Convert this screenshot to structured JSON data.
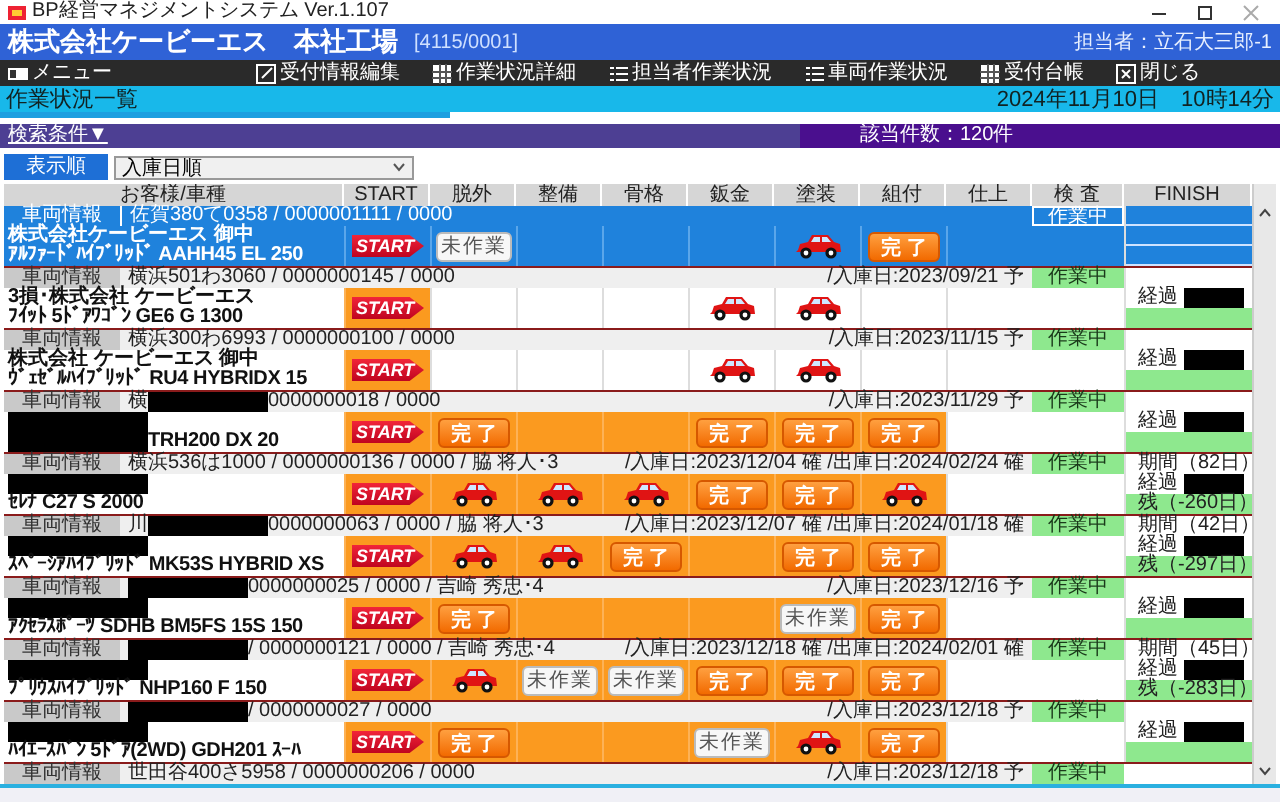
{
  "window": {
    "title": "BP経営マネジメントシステム Ver.1.107"
  },
  "header": {
    "company": "株式会社ケービーエス　本社工場",
    "code": "[4115/0001]",
    "user": "担当者：立石大三郎-1"
  },
  "toolbar": {
    "items": [
      {
        "label": "メニュー"
      },
      {
        "label": "受付情報編集"
      },
      {
        "label": "作業状況詳細"
      },
      {
        "label": "担当者作業状況"
      },
      {
        "label": "車両作業状況"
      },
      {
        "label": "受付台帳"
      }
    ],
    "close": "閉じる"
  },
  "page": {
    "title": "作業状況一覧",
    "datetime": "2024年11月10日　10時14分"
  },
  "search": {
    "label": "検索条件▼",
    "count": "該当件数：120件",
    "sort_button": "表示順",
    "sort_value": "入庫日順"
  },
  "table": {
    "columns": [
      "お客様/車種",
      "START",
      "脱外",
      "整備",
      "骨格",
      "鈑金",
      "塗装",
      "組付",
      "仕上",
      "検 査",
      "FINISH"
    ],
    "rows": [
      {
        "selected": true,
        "info_label": "車両情報",
        "plate": "佐賀380て0358 / 0000001111 / 0000",
        "customer": "株式会社ケービーエス 御中",
        "car": "ｱﾙﾌｧｰﾄﾞﾊｲﾌﾞﾘｯﾄﾞ AAHH45 EL 250",
        "stages": [
          {
            "kind": "start",
            "label": "START"
          },
          {
            "kind": "todo",
            "label": "未作業"
          },
          {
            "kind": "blank"
          },
          {
            "kind": "blank"
          },
          {
            "kind": "blank"
          },
          {
            "kind": "car"
          },
          {
            "kind": "done",
            "label": "完 了"
          },
          {
            "kind": "blank"
          }
        ],
        "inspection": "作業中"
      },
      {
        "selected": false,
        "info_label": "車両情報",
        "plate": "横浜501わ3060 / 0000000145 / 0000",
        "dates": "/入庫日:2023/09/21 予",
        "customer": "3損･株式会社 ケービーエス",
        "car": "ﾌｲｯﾄ 5ﾄﾞｱﾜｺﾞﾝ GE6 G 1300",
        "stages": [
          {
            "kind": "start",
            "label": "START",
            "active": true
          },
          {
            "kind": "blank",
            "active": false
          },
          {
            "kind": "blank",
            "active": false
          },
          {
            "kind": "blank",
            "active": false
          },
          {
            "kind": "car",
            "active": false
          },
          {
            "kind": "car",
            "active": false
          },
          {
            "kind": "blank",
            "active": false
          },
          {
            "kind": "blank",
            "active": false
          }
        ],
        "inspection": "作業中",
        "finish": {
          "elapsed": "経過",
          "elapsed_redacted": true
        }
      },
      {
        "selected": false,
        "info_label": "車両情報",
        "plate": "横浜300わ6993 / 0000000100 / 0000",
        "dates": "/入庫日:2023/11/15 予",
        "customer": "株式会社 ケービーエス 御中",
        "car": "ｳﾞｪｾﾞﾙﾊｲﾌﾞﾘｯﾄﾞ RU4 HYBRIDX 15",
        "stages": [
          {
            "kind": "start",
            "label": "START",
            "active": true
          },
          {
            "kind": "blank",
            "active": false
          },
          {
            "kind": "blank",
            "active": false
          },
          {
            "kind": "blank",
            "active": false
          },
          {
            "kind": "car",
            "active": false
          },
          {
            "kind": "car",
            "active": false
          },
          {
            "kind": "blank",
            "active": false
          },
          {
            "kind": "blank",
            "active": false
          }
        ],
        "inspection": "作業中",
        "finish": {
          "elapsed": "経過",
          "elapsed_redacted": true
        }
      },
      {
        "selected": false,
        "info_label": "車両情報",
        "plate_prefix": "横",
        "plate_redacted": true,
        "plate": "0000000018 / 0000",
        "dates": "/入庫日:2023/11/29 予",
        "customer_redacted": true,
        "car_redacted": true,
        "car": "TRH200 DX 20",
        "stages": [
          {
            "kind": "start",
            "label": "START",
            "active": true
          },
          {
            "kind": "done",
            "label": "完 了",
            "active": true
          },
          {
            "kind": "blank",
            "active": true
          },
          {
            "kind": "blank",
            "active": true
          },
          {
            "kind": "done",
            "label": "完 了",
            "active": true
          },
          {
            "kind": "done",
            "label": "完 了",
            "active": true
          },
          {
            "kind": "done",
            "label": "完 了",
            "active": true
          },
          {
            "kind": "blank",
            "active": false
          }
        ],
        "inspection": "作業中",
        "finish": {
          "elapsed": "経過",
          "elapsed_redacted": true
        }
      },
      {
        "selected": false,
        "info_label": "車両情報",
        "plate": "横浜536は1000 / 0000000136 / 0000 / 脇 将人･3",
        "dates": "/入庫日:2023/12/04 確 /出庫日:2024/02/24 確",
        "customer_redacted": true,
        "car": "ｾﾚﾅ C27 S 2000",
        "stages": [
          {
            "kind": "start",
            "label": "START",
            "active": true
          },
          {
            "kind": "car",
            "active": true
          },
          {
            "kind": "car",
            "active": true
          },
          {
            "kind": "car",
            "active": true
          },
          {
            "kind": "done",
            "label": "完 了",
            "active": true
          },
          {
            "kind": "done",
            "label": "完 了",
            "active": true
          },
          {
            "kind": "car",
            "active": true
          },
          {
            "kind": "blank",
            "active": false
          }
        ],
        "inspection": "作業中",
        "finish": {
          "period": "期間（82日）",
          "elapsed": "経過",
          "elapsed_redacted": true,
          "remaining": "残（-260日）"
        }
      },
      {
        "selected": false,
        "info_label": "車両情報",
        "plate_prefix": "川",
        "plate_redacted": true,
        "plate": "0000000063 / 0000 / 脇 将人･3",
        "dates": "/入庫日:2023/12/07 確 /出庫日:2024/01/18 確",
        "customer_redacted": true,
        "car": "ｽﾍﾟｰｼｱﾊｲﾌﾞﾘｯﾄﾞ MK53S HYBRID XS",
        "stages": [
          {
            "kind": "start",
            "label": "START",
            "active": true
          },
          {
            "kind": "car",
            "active": true
          },
          {
            "kind": "car",
            "active": true
          },
          {
            "kind": "done",
            "label": "完 了",
            "active": true
          },
          {
            "kind": "blank",
            "active": true
          },
          {
            "kind": "done",
            "label": "完 了",
            "active": true
          },
          {
            "kind": "done",
            "label": "完 了",
            "active": true
          },
          {
            "kind": "blank",
            "active": false
          }
        ],
        "inspection": "作業中",
        "finish": {
          "period": "期間（42日）",
          "elapsed": "経過",
          "elapsed_redacted": true,
          "remaining": "残（-297日）"
        }
      },
      {
        "selected": false,
        "info_label": "車両情報",
        "plate_redacted": true,
        "plate": "0000000025 / 0000 / 吉崎 秀忠･4",
        "dates": "/入庫日:2023/12/16 予",
        "customer_redacted": true,
        "car": "ｱｸｾﾗｽﾎﾟｰﾂ SDHB BM5FS 15S 150",
        "stages": [
          {
            "kind": "start",
            "label": "START",
            "active": true
          },
          {
            "kind": "done",
            "label": "完 了",
            "active": true
          },
          {
            "kind": "blank",
            "active": true
          },
          {
            "kind": "blank",
            "active": true
          },
          {
            "kind": "blank",
            "active": true
          },
          {
            "kind": "todo",
            "label": "未作業",
            "active": true
          },
          {
            "kind": "done",
            "label": "完 了",
            "active": true
          },
          {
            "kind": "blank",
            "active": false
          }
        ],
        "inspection": "作業中",
        "finish": {
          "elapsed": "経過",
          "elapsed_redacted": true
        }
      },
      {
        "selected": false,
        "info_label": "車両情報",
        "plate_redacted": true,
        "plate": "/ 0000000121 / 0000 / 吉崎 秀忠･4",
        "dates": "/入庫日:2023/12/18 確 /出庫日:2024/02/01 確",
        "customer_redacted": true,
        "car": "ﾌﾟﾘｳｽﾊｲﾌﾞﾘｯﾄﾞ NHP160 F 150",
        "stages": [
          {
            "kind": "start",
            "label": "START",
            "active": true
          },
          {
            "kind": "car",
            "active": true
          },
          {
            "kind": "todo",
            "label": "未作業",
            "active": true
          },
          {
            "kind": "todo",
            "label": "未作業",
            "active": true
          },
          {
            "kind": "done",
            "label": "完 了",
            "active": true
          },
          {
            "kind": "done",
            "label": "完 了",
            "active": true
          },
          {
            "kind": "done",
            "label": "完 了",
            "active": true
          },
          {
            "kind": "blank",
            "active": false
          }
        ],
        "inspection": "作業中",
        "finish": {
          "period": "期間（45日）",
          "elapsed": "経過",
          "elapsed_redacted": true,
          "remaining": "残（-283日）"
        }
      },
      {
        "selected": false,
        "info_label": "車両情報",
        "plate_redacted": true,
        "plate": "/ 0000000027 / 0000",
        "dates": "/入庫日:2023/12/18 予",
        "customer_redacted": true,
        "car": "ﾊｲｴｰｽﾊﾞﾝ 5ﾄﾞｱ(2WD) GDH201 ｽｰﾊ",
        "stages": [
          {
            "kind": "start",
            "label": "START",
            "active": true
          },
          {
            "kind": "done",
            "label": "完 了",
            "active": true
          },
          {
            "kind": "blank",
            "active": true
          },
          {
            "kind": "blank",
            "active": true
          },
          {
            "kind": "todo",
            "label": "未作業",
            "active": true
          },
          {
            "kind": "car",
            "active": true
          },
          {
            "kind": "done",
            "label": "完 了",
            "active": true
          },
          {
            "kind": "blank",
            "active": false
          }
        ],
        "inspection": "作業中",
        "finish": {
          "elapsed": "経過",
          "elapsed_redacted": true
        }
      },
      {
        "selected": false,
        "info_label": "車両情報",
        "plate": "世田谷400さ5958 / 0000000206 / 0000",
        "dates": "/入庫日:2023/12/18 予",
        "inspection": "作業中"
      }
    ]
  }
}
